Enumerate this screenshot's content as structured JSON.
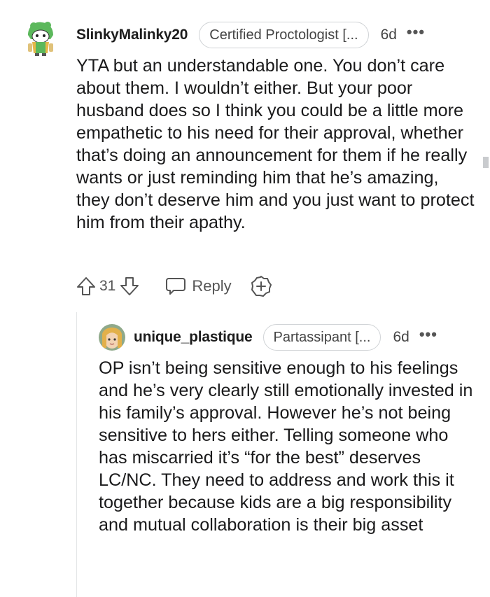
{
  "comments": [
    {
      "author": "SlinkyMalinky20",
      "flair": "Certified Proctologist [...",
      "age": "6d",
      "more_label": "•••",
      "body": "YTA but an understandable one. You don’t care about them. I wouldn’t either. But your poor husband does so I think you could be a little more empathetic to his need for their approval, whether that’s doing an announcement for them if he really wants or just reminding him that he’s amazing, they don’t deserve him and you just want to protect him from their apathy.",
      "score": "31",
      "reply_label": "Reply",
      "icons": {
        "avatar": "snoo-avatar-icon",
        "upvote": "upvote-arrow-icon",
        "downvote": "downvote-arrow-icon",
        "reply": "speech-bubble-icon",
        "award": "award-plus-icon"
      }
    },
    {
      "author": "unique_plastique",
      "flair": "Partassipant [...",
      "age": "6d",
      "more_label": "•••",
      "body": "OP isn’t being sensitive enough to his feelings and he’s very clearly still emotionally invested in his family’s approval. However he’s not being sensitive to hers either. Telling someone who has miscarried it’s “for the best” deserves LC/NC. They need to address and work this it together because kids are a big responsibility and mutual collaboration is their big asset",
      "icons": {
        "avatar": "user-avatar-icon"
      }
    }
  ],
  "colors": {
    "text": "#1a1a1b",
    "meta": "#555555",
    "flair_border": "#d0d3d6",
    "thread_line": "#e3e5e7"
  }
}
